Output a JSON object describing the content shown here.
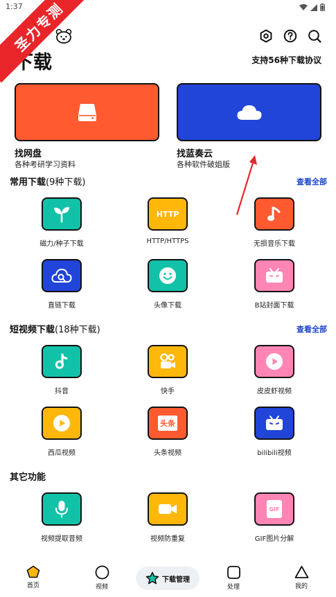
{
  "status_bar": {
    "time": "1:37"
  },
  "ribbon": {
    "text": "圣力专测"
  },
  "header": {
    "title": "下载",
    "protocols": "支持56种下载协议"
  },
  "top_icons": [
    "settings-icon",
    "help-icon",
    "search-icon"
  ],
  "cards": [
    {
      "title": "找网盘",
      "subtitle": "各种考研学习资料",
      "color": "#ff5a30",
      "icon": "drive-icon"
    },
    {
      "title": "找蓝奏云",
      "subtitle": "各种软件破姐版",
      "color": "#2145d8",
      "icon": "cloud-icon"
    }
  ],
  "sections": {
    "common": {
      "title": "常用下载",
      "count": "(9种下载)",
      "see_all": "查看全部",
      "items": [
        {
          "label": "磁力/种子下载",
          "color": "#12c2a8",
          "icon": "sprout-icon"
        },
        {
          "label": "HTTP/HTTPS",
          "color": "#ffb70a",
          "icon": "http-icon",
          "icon_text": "HTTP"
        },
        {
          "label": "无损音乐下载",
          "color": "#ff5a30",
          "icon": "music-note-icon"
        },
        {
          "label": "直链下载",
          "color": "#2145d8",
          "icon": "cloud-link-icon"
        },
        {
          "label": "头像下载",
          "color": "#12c2a8",
          "icon": "smiley-icon"
        },
        {
          "label": "B站封面下载",
          "color": "#ff86b4",
          "icon": "bilibili-tv-icon"
        }
      ]
    },
    "short_video": {
      "title": "短视频下载",
      "count": "(18种下载)",
      "see_all": "查看全部",
      "items": [
        {
          "label": "抖音",
          "color": "#12c2a8",
          "icon": "douyin-icon"
        },
        {
          "label": "快手",
          "color": "#ffb70a",
          "icon": "kuaishou-icon"
        },
        {
          "label": "皮皮虾视频",
          "color": "#ff86b4",
          "icon": "play-circle-icon"
        },
        {
          "label": "西瓜视频",
          "color": "#ffb70a",
          "icon": "play-circle-icon"
        },
        {
          "label": "头条视频",
          "color": "#ff5a30",
          "icon": "toutiao-icon",
          "icon_text": "头条"
        },
        {
          "label": "bilibili视频",
          "color": "#2145d8",
          "icon": "bilibili-tv-icon"
        }
      ]
    },
    "other": {
      "title": "其它功能",
      "items": [
        {
          "label": "视频提取音频",
          "color": "#12c2a8",
          "icon": "microphone-icon"
        },
        {
          "label": "视频防重复",
          "color": "#ffb70a",
          "icon": "video-camera-icon"
        },
        {
          "label": "GIF图片分解",
          "color": "#ff86b4",
          "icon": "gif-icon",
          "icon_text": "GIF"
        }
      ]
    }
  },
  "bottom_nav": {
    "home": "首页",
    "video": "视频",
    "download_manager": "下载管理",
    "process": "处理",
    "mine": "我的"
  }
}
